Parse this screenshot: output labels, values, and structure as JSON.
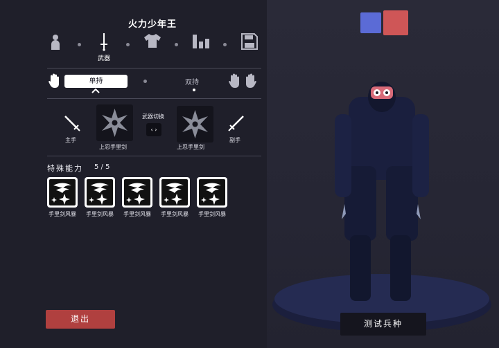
{
  "unit": {
    "name": "火力少年王"
  },
  "steps": [
    {
      "icon": "person-icon",
      "label": ""
    },
    {
      "icon": "sword-icon",
      "label": "武器"
    },
    {
      "icon": "shirt-icon",
      "label": ""
    },
    {
      "icon": "stats-icon",
      "label": ""
    },
    {
      "icon": "save-icon",
      "label": ""
    }
  ],
  "grip": {
    "single_label": "单持",
    "dual_label": "双持",
    "selected": "single"
  },
  "weapons": {
    "swap_label": "武器切换",
    "swap_symbol": "‹ ›",
    "main_hand_label": "主手",
    "off_hand_label": "副手",
    "main_weapon_name": "上忍手里剑",
    "off_weapon_name": "上忍手里剑"
  },
  "abilities": {
    "heading": "特殊能力",
    "count": "5 / 5",
    "items": [
      {
        "label": "手里剑风暴"
      },
      {
        "label": "手里剑风暴"
      },
      {
        "label": "手里剑风暴"
      },
      {
        "label": "手里剑风暴"
      },
      {
        "label": "手里剑风暴"
      }
    ]
  },
  "buttons": {
    "exit": "退出",
    "test_unit": "测试兵种"
  },
  "colors": {
    "team_blue": "#5b6bd6",
    "team_red": "#cf5657",
    "exit": "#b0403f"
  }
}
